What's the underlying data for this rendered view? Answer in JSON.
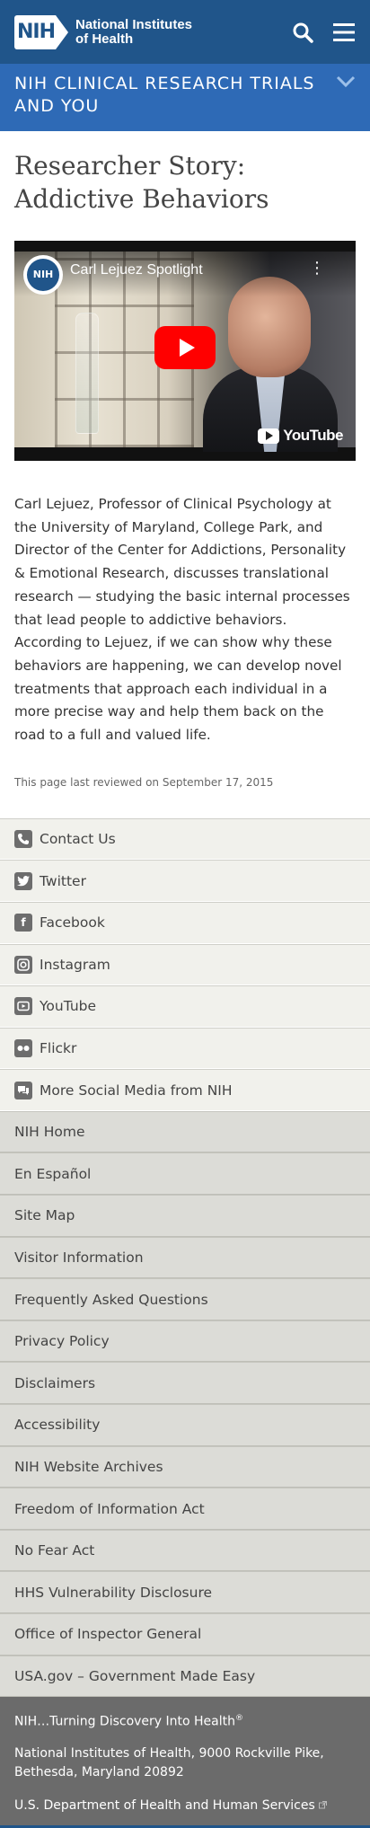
{
  "header": {
    "logo_mark": "NIH",
    "logo_line1": "National Institutes",
    "logo_line2": "of Health",
    "icons": [
      "search-icon",
      "menu-icon"
    ]
  },
  "section": {
    "title": "NIH CLINICAL RESEARCH TRIALS AND YOU",
    "toggle_icon": "chevron-down-icon"
  },
  "page": {
    "title": "Researcher Story: Addictive Behaviors",
    "video": {
      "channel_badge": "NIH",
      "title": "Carl Lejuez Spotlight",
      "brand": "YouTube"
    },
    "story": "Carl Lejuez, Professor of Clinical Psychology at the University of Maryland, College Park, and Director of the Center for Addictions, Personality & Emotional Research, discusses translational research — studying the basic internal processes that lead people to addictive behaviors. According to Lejuez, if we can show why these behaviors are happening, we can develop novel treatments that approach each individual in a more precise way and help them back on the road to a full and valued life.",
    "reviewed": "This page last reviewed on September 17, 2015"
  },
  "social": [
    {
      "label": "Contact Us",
      "icon": "phone-icon"
    },
    {
      "label": "Twitter",
      "icon": "twitter-icon"
    },
    {
      "label": "Facebook",
      "icon": "facebook-icon"
    },
    {
      "label": "Instagram",
      "icon": "instagram-icon"
    },
    {
      "label": "YouTube",
      "icon": "youtube-icon"
    },
    {
      "label": "Flickr",
      "icon": "flickr-icon"
    },
    {
      "label": "More Social Media from NIH",
      "icon": "social-media-icon"
    }
  ],
  "links": [
    "NIH Home",
    "En Español",
    "Site Map",
    "Visitor Information",
    "Frequently Asked Questions",
    "Privacy Policy",
    "Disclaimers",
    "Accessibility",
    "NIH Website Archives",
    "Freedom of Information Act",
    "No Fear Act",
    "HHS Vulnerability Disclosure",
    "Office of Inspector General",
    "USA.gov – Government Made Easy"
  ],
  "footer": {
    "tagline": "NIH…Turning Discovery Into Health",
    "tagline_mark": "®",
    "address": "National Institutes of Health, 9000 Rockville Pike, Bethesda, Maryland 20892",
    "hhs": "U.S. Department of Health and Human Services"
  },
  "colors": {
    "header_bg": "#20558a",
    "section_bg": "#2e6ab6",
    "footer_bg": "#6b6b6b",
    "youtube_red": "#ff0000"
  }
}
